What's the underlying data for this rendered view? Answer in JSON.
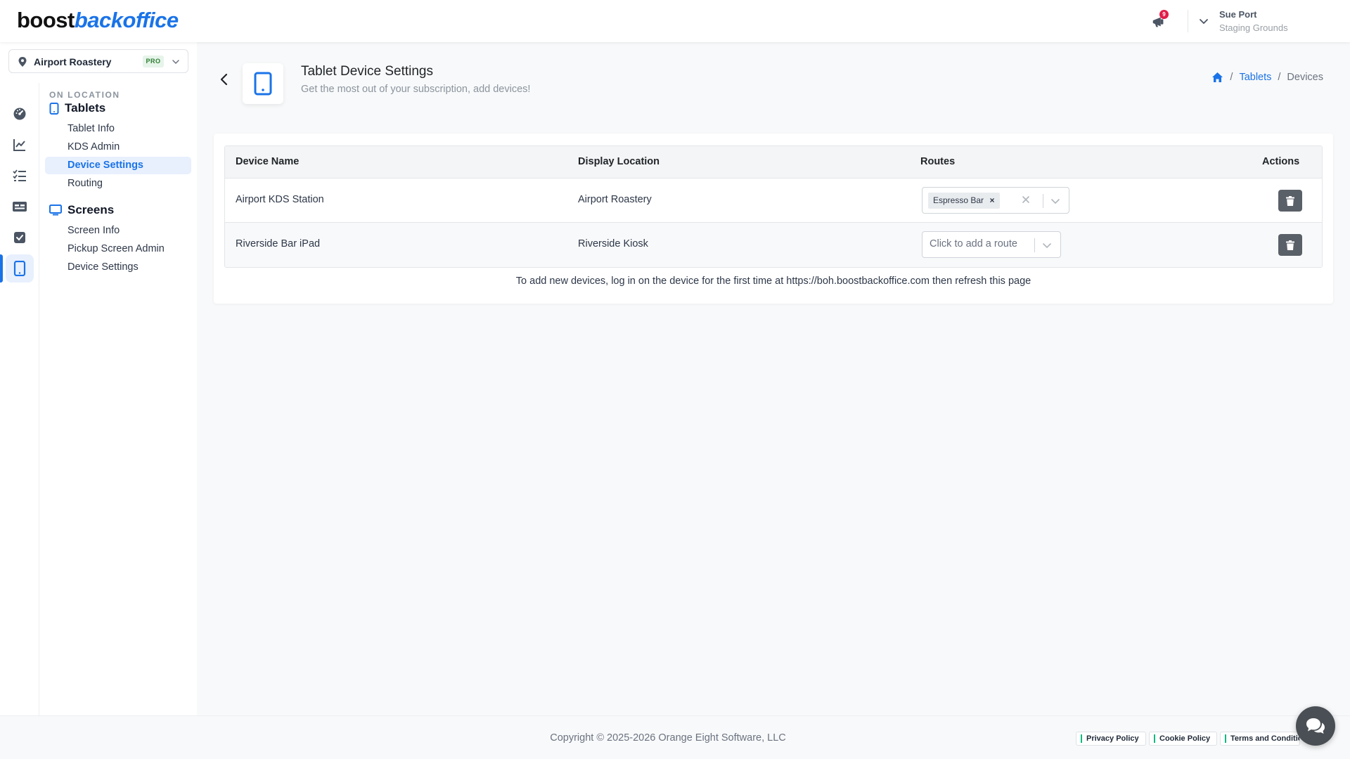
{
  "brand": {
    "part1": "boost",
    "part2": "backoffice"
  },
  "header": {
    "notification_count": "9",
    "user_name": "Sue Port",
    "user_org": "Staging Grounds"
  },
  "location_selector": {
    "name": "Airport Roastery",
    "plan_badge": "PRO"
  },
  "rail_icons": [
    "dashboard-icon",
    "analytics-icon",
    "checklist-icon",
    "card-icon",
    "tasks-icon",
    "tablet-icon"
  ],
  "menu": {
    "section": "ON LOCATION",
    "tablets": {
      "label": "Tablets",
      "items": [
        "Tablet Info",
        "KDS Admin",
        "Device Settings",
        "Routing"
      ]
    },
    "screens": {
      "label": "Screens",
      "items": [
        "Screen Info",
        "Pickup Screen Admin",
        "Device Settings"
      ]
    }
  },
  "page": {
    "title": "Tablet Device Settings",
    "subtitle": "Get the most out of your subscription, add devices!",
    "breadcrumb": {
      "link": "Tablets",
      "current": "Devices",
      "separator": "/"
    }
  },
  "table": {
    "columns": [
      "Device Name",
      "Display Location",
      "Routes",
      "Actions"
    ],
    "rows": [
      {
        "device_name": "Airport KDS Station",
        "display_location": "Airport Roastery",
        "route": "Espresso Bar"
      },
      {
        "device_name": "Riverside Bar iPad",
        "display_location": "Riverside Kiosk",
        "route_placeholder": "Click to add a route"
      }
    ],
    "help_text": "To add new devices, log in on the device for the first time at https://boh.boostbackoffice.com then refresh this page"
  },
  "footer": {
    "copyright": "Copyright © 2025-2026 Orange Eight Software, LLC",
    "links": [
      "Privacy Policy",
      "Cookie Policy",
      "Terms and Conditions"
    ]
  },
  "colors": {
    "accent": "#1a73e8",
    "badge": "#e11d48",
    "pro": "#2e7d32",
    "delete": "#5a6068"
  }
}
